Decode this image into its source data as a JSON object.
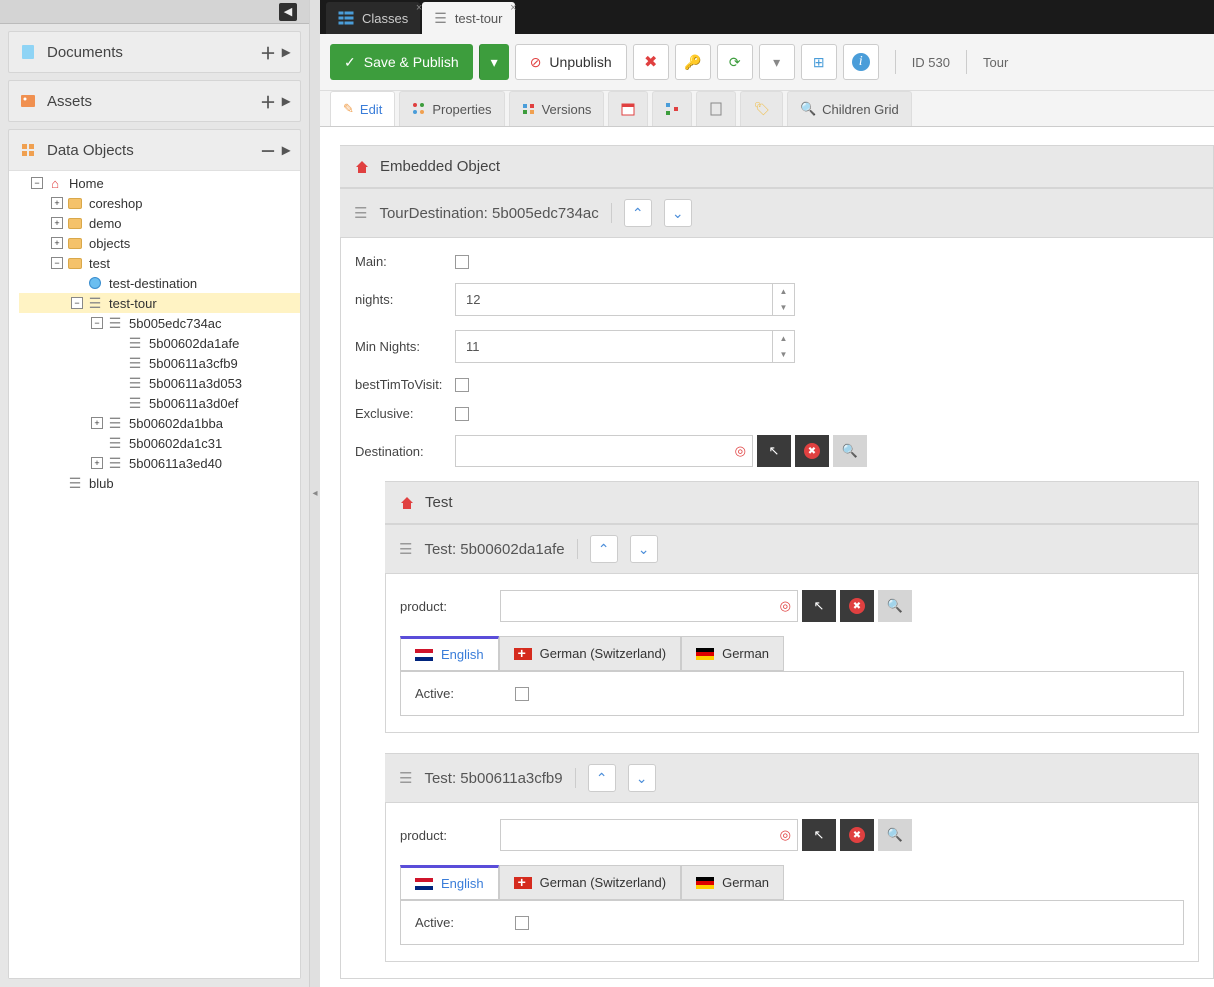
{
  "sidebar": {
    "panels": {
      "documents": "Documents",
      "assets": "Assets",
      "dataobjects": "Data Objects"
    },
    "tree": {
      "home": "Home",
      "coreshop": "coreshop",
      "demo": "demo",
      "objects": "objects",
      "test": "test",
      "testdestination": "test-destination",
      "testtour": "test-tour",
      "n1": "5b005edc734ac",
      "n1a": "5b00602da1afe",
      "n1b": "5b00611a3cfb9",
      "n1c": "5b00611a3d053",
      "n1d": "5b00611a3d0ef",
      "n2": "5b00602da1bba",
      "n3": "5b00602da1c31",
      "n4": "5b00611a3ed40",
      "blub": "blub"
    }
  },
  "tabs": {
    "classes": "Classes",
    "current": "test-tour"
  },
  "toolbar": {
    "save": "Save & Publish",
    "unpublish": "Unpublish",
    "id": "ID 530",
    "type": "Tour"
  },
  "subtabs": {
    "edit": "Edit",
    "properties": "Properties",
    "versions": "Versions",
    "children": "Children Grid"
  },
  "content": {
    "embedded_title": "Embedded Object",
    "dest_block_title": "TourDestination: 5b005edc734ac",
    "main_label": "Main:",
    "nights_label": "nights:",
    "nights_value": "12",
    "minnights_label": "Min Nights:",
    "minnights_value": "11",
    "bestTime_label": "bestTimToVisit:",
    "exclusive_label": "Exclusive:",
    "destination_label": "Destination:",
    "test_section": "Test",
    "test1_title": "Test: 5b00602da1afe",
    "test2_title": "Test: 5b00611a3cfb9",
    "product_label": "product:",
    "lang_en": "English",
    "lang_dech": "German (Switzerland)",
    "lang_de": "German",
    "active_label": "Active:"
  }
}
